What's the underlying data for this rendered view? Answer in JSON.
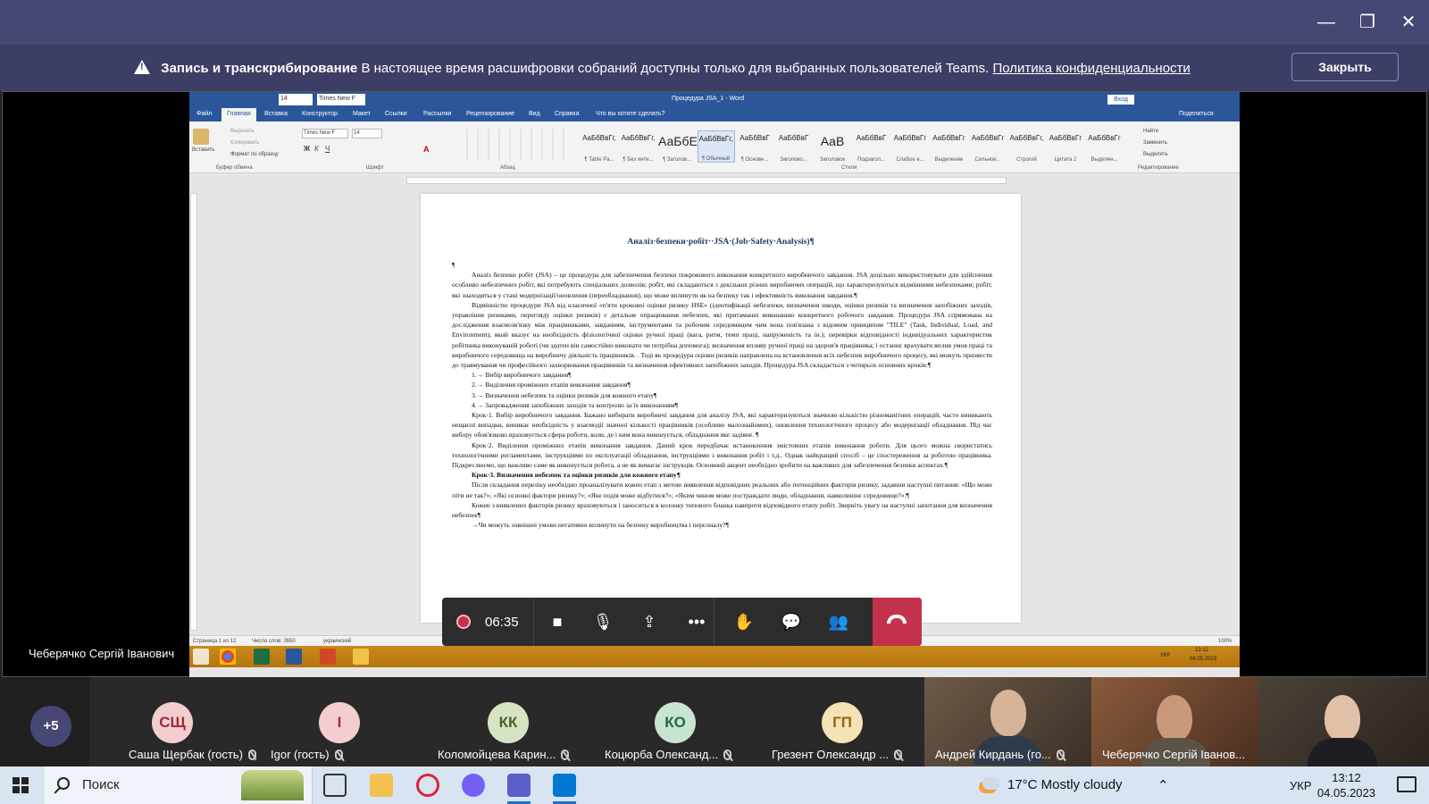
{
  "window": {
    "minimize": "—",
    "maximize": "❐",
    "close": "✕"
  },
  "banner": {
    "title": "Запись и транскрибирование",
    "message": "В настоящее время расшифровки собраний доступны только для выбранных пользователей Teams.",
    "link": "Политика конфиденциальности",
    "close_label": "Закрыть"
  },
  "word": {
    "title": "Процедура JSA_1 - Word",
    "font_size_box": "14",
    "font_name_box": "Times New F",
    "signin": "Вход",
    "share": "Поделиться",
    "tabs": [
      "Файл",
      "Главная",
      "Вставка",
      "Конструктор",
      "Макет",
      "Ссылки",
      "Рассылки",
      "Рецензирование",
      "Вид",
      "Справка",
      "Что вы хотите сделать?"
    ],
    "ribbon": {
      "paste": "Вставить",
      "cut": "Вырезать",
      "copy": "Копировать",
      "format_painter": "Формат по образцу",
      "group_clipboard": "Буфер обмена",
      "group_font": "Шрифт",
      "group_paragraph": "Абзац",
      "group_styles": "Стили",
      "group_editing": "Редактирование",
      "font": "Times New F",
      "size": "14",
      "find": "Найти",
      "replace": "Заменить",
      "select": "Выделить",
      "styles": [
        {
          "sample": "АаБбВвГг,",
          "name": "¶ Table Pa..."
        },
        {
          "sample": "АаБбВвГг,",
          "name": "¶ Без инте..."
        },
        {
          "sample": "АаБбЕ",
          "name": "¶ Заголов..."
        },
        {
          "sample": "АаБбВвГг,",
          "name": "¶ Обычный"
        },
        {
          "sample": "АаБбВвГ",
          "name": "¶ Основн..."
        },
        {
          "sample": "АаБбВвГ",
          "name": "Заголово..."
        },
        {
          "sample": "АаВ",
          "name": "Заголовок"
        },
        {
          "sample": "АаБбВвГ",
          "name": "Подзагол..."
        },
        {
          "sample": "АаБбВвГг",
          "name": "Слабое в..."
        },
        {
          "sample": "АаБбВвГг",
          "name": "Выделение"
        },
        {
          "sample": "АаБбВвГг",
          "name": "Сильное..."
        },
        {
          "sample": "АаБбВвГг,",
          "name": "Строгий"
        },
        {
          "sample": "АаБбВвГг",
          "name": "Цитата 2"
        },
        {
          "sample": "АаБбВвГг",
          "name": "Выделен..."
        }
      ]
    },
    "doc": {
      "title": "Аналіз·безпеки·робіт··JSA·(Job·Safety·Analysis)¶",
      "para1": "Аналіз безпеки робіт (JSA) – це процедура для забезпечення безпеки покрокового виконання конкретного виробничого завдання. JSA доцільно використовувати для здійснення особливо небезпечних робіт, які потребують спеціальних дозволів; робіт, які складаються з декількох різних виробничих операцій, що характеризуються відмінними небезпеками; робіт, які знаходяться у стані модернізації/оновлення (переобладнання), що може вплинути як на безпеку так і ефективність виконання завдання.¶",
      "para2": "Відмінністю процедури JSA від класичної «п'яти кроковоі оцінки ризику HSE» (ідентифікації небезпеки, визначення шкоди, оцінки ризиків та визначення запобіжних заходів, управління ризиками, перегляду оцінки ризиків) є детальне опрацювання небезпек, які притаманні виконанню конкретного робочого завдання. Процедура JSA спрямована на дослідження взаємозв'язку між працівниками, завданням, інструментами та робочим середовищем чим вона пов'язана з відомим принципом \"TILE\" (Task, Individual, Load, and Environment), який вказує на необхідність фізіологічної оцінки ручної праці (вага, ритм, темп праці, напруженість та ін.); перевірки відповідності індивідуальних характеристик робітника виконуваній роботі (чи здатен він самостійно виконати чи потрібна допомога); визначення впливу ручної праці на здоров'я працівника; і останнє врахувати вплив умов праці та виробничого середовища на виробничу діяльність працівників. . Тоді як процедура оцінки ризиків направлена на встановлення всіх небезпек виробничого процесу, які можуть призвести до травмування чи професійного захворювання працівників та визначення ефективних запобіжних заходів. Процедура JSA складається з чотирьох основних кроків:¶",
      "steps": [
        "1.→ Вибір виробничого завдання¶",
        "2.→ Виділення проміжних етапів виконання завдання¶",
        "3.→ Визначення небезпек та оцінки ризиків для кожного етапу¶",
        "4.→ Запровадження запобіжних заходів та контролю за їх виконанням¶"
      ],
      "step1": "Крок·1. Вибір виробничого завдання. Бажано вибирати виробничі завдання для аналізу JSA, які характеризуються значною кількістю різноманітних операцій, часто виникають нещасні випадки, виникає необхідність у взаємодії значної кількості працівників (особливо малознайомих), оновлення технологічного процесу або модернізації обладнання. Під час вибору обов'язково враховується сфера роботи, коли, де і ким вона виконується, обладнання яке задіяне. ¶",
      "step2": "Крок·2. Виділення проміжних етапів виконання завдання. Даний крок передбачає встановлення змістовних етапів виконання роботи. Для цього можна скористатись технологічними регламентами, інструкціями по експлуатації обладнання, інструкціями з виконання робіт і т.д.. Однак найкращий спосіб – це спостереження за роботою працівника. Підкреслюємо, що важливо саме як виконується робота, а не як вимагає інструкція. Основний акцент необхідно зробити на важливих для забезпечення безпеки аспектах.¶",
      "step3_title": "Крок·3. Визначення небезпек та оцінки ризиків для кожного етапу¶",
      "step3": "Після складання переліку необхідно проаналізувати кожен етап з метою виявлення відповідних реальних або потенційних факторів ризику, задавши наступні питання: «Що може піти не так?»; «Які основні фактори ризику?»; «Яке подія може відбутися?»; «Яким чином може постраждати люди, обладнання, навколишнє середовище?».¶",
      "step3b": "Кожен з виявлених факторів ризику враховуються і заноситься в колонку типового бланка навпроти відповідного етапу робіт. Зверніть увагу на наступні запитання для визначення небезпек¶",
      "step3c": "→Чи можуть зовнішні умови негативно вплинути на безпеку виробництва і персоналу?¶"
    },
    "status": {
      "page": "Страница 1 из 12",
      "words": "Число слов: 2650",
      "lang": "украинский",
      "zoom": "100%",
      "tray_lang": "УКР",
      "tray_time": "13:12",
      "tray_date": "04.05.2023"
    }
  },
  "call": {
    "timer": "06:35",
    "presenter": "Чеберячко Сергій Іванович"
  },
  "participants": {
    "more": "+5",
    "list": [
      {
        "initials": "СЩ",
        "name": "Саша Щербак (гость)",
        "bg": "#f4cdd0",
        "fg": "#a12a3a"
      },
      {
        "initials": "I",
        "name": "Igor (гость)",
        "bg": "#f4cdd0",
        "fg": "#a12a3a"
      },
      {
        "initials": "КК",
        "name": "Коломойцева Карин...",
        "bg": "#d7e4c4",
        "fg": "#4a5f2a"
      },
      {
        "initials": "КО",
        "name": "Коцюрба Олександ...",
        "bg": "#c8e4d2",
        "fg": "#236b3e"
      },
      {
        "initials": "ГП",
        "name": "Грезент Олександр ...",
        "bg": "#f4e3b5",
        "fg": "#8a6a10"
      }
    ],
    "video": [
      {
        "name": "Андрей Кирдань (го..."
      },
      {
        "name": "Чеберячко Сергій Іванов..."
      },
      {
        "name": ""
      }
    ]
  },
  "taskbar": {
    "search": "Поиск",
    "weather": "17°C  Mostly cloudy",
    "lang": "УКР",
    "time": "13:12",
    "date": "04.05.2023"
  }
}
